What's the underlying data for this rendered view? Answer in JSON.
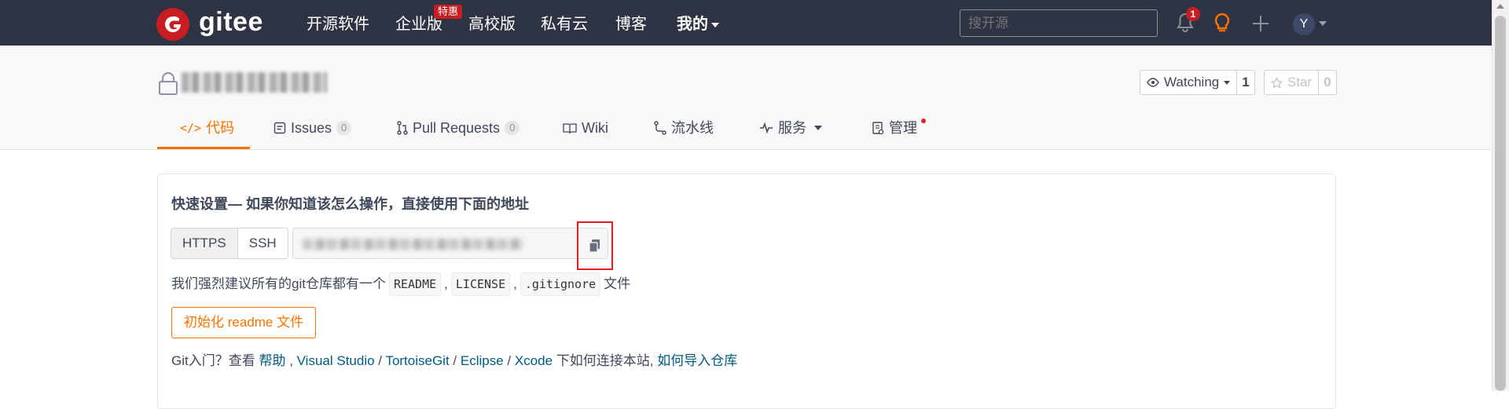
{
  "nav": {
    "brand": "gitee",
    "items": [
      "开源软件",
      "企业版",
      "高校版",
      "私有云",
      "博客",
      "我的"
    ],
    "badge": "特惠",
    "search_placeholder": "搜开源",
    "notifications_count": "1",
    "avatar_letter": "Y"
  },
  "repo": {
    "watch_label": "Watching",
    "watch_count": "1",
    "star_label": "Star",
    "star_count": "0"
  },
  "tabs": [
    {
      "label": "代码",
      "icon": "code-icon",
      "active": true
    },
    {
      "label": "Issues",
      "icon": "issues-icon",
      "count": "0"
    },
    {
      "label": "Pull Requests",
      "icon": "pull-request-icon",
      "count": "0"
    },
    {
      "label": "Wiki",
      "icon": "book-icon"
    },
    {
      "label": "流水线",
      "icon": "pipeline-icon"
    },
    {
      "label": "服务",
      "icon": "pulse-icon"
    },
    {
      "label": "管理",
      "icon": "manage-icon"
    }
  ],
  "quick_setup": {
    "title": "快速设置— 如果你知道该怎么操作，直接使用下面的地址",
    "protocols": [
      "HTTPS",
      "SSH"
    ],
    "hint_prefix": "我们强烈建议所有的git仓库都有一个",
    "hint_files": [
      "README",
      "LICENSE",
      ".gitignore"
    ],
    "hint_suffix": "文件",
    "init_button": "初始化 readme 文件",
    "help_prefix": "Git入门？查看",
    "help_link": "帮助",
    "tools": [
      "Visual Studio",
      "TortoiseGit",
      "Eclipse",
      "Xcode"
    ],
    "help_middle": "下如何连接本站,",
    "import_link": "如何导入仓库"
  },
  "colors": {
    "navbar": "#2e3444",
    "accent": "#fe7300",
    "brand_red": "#c71d23",
    "link": "#005980"
  }
}
